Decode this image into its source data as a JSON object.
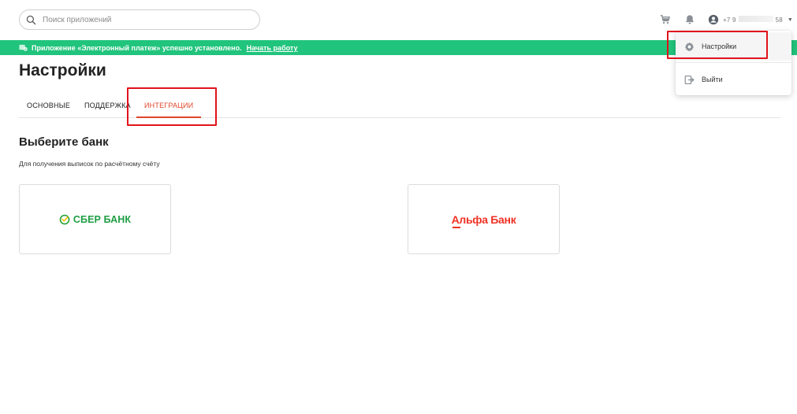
{
  "search": {
    "placeholder": "Поиск приложений"
  },
  "header": {
    "icons": [
      "cart-icon",
      "bell-icon",
      "user-icon",
      "caret-down-icon"
    ],
    "user_phone_visible_prefix": "+7 9",
    "user_phone_visible_suffix": "58"
  },
  "banner": {
    "message": "Приложение «Электронный платеж» успешно установлено.",
    "link": "Начать работу",
    "color": "#21c47c"
  },
  "page": {
    "title": "Настройки"
  },
  "tabs": [
    {
      "label": "ОСНОВНЫЕ",
      "active": false
    },
    {
      "label": "ПОДДЕРЖКА",
      "active": false
    },
    {
      "label": "ИНТЕГРАЦИИ",
      "active": true
    }
  ],
  "section": {
    "title": "Выберите банк",
    "subtitle": "Для получения выписок по расчётному счёту"
  },
  "banks": [
    {
      "name": "СБЕР БАНК",
      "color": "#1f9e43"
    },
    {
      "name": "Альфа Банк",
      "color": "#ef3124"
    }
  ],
  "dropdown": {
    "items": [
      {
        "label": "Настройки",
        "icon": "gear-icon"
      },
      {
        "label": "Выйти",
        "icon": "logout-icon"
      }
    ]
  },
  "colors": {
    "accent": "#e0452b",
    "highlight": "#e1131b"
  }
}
